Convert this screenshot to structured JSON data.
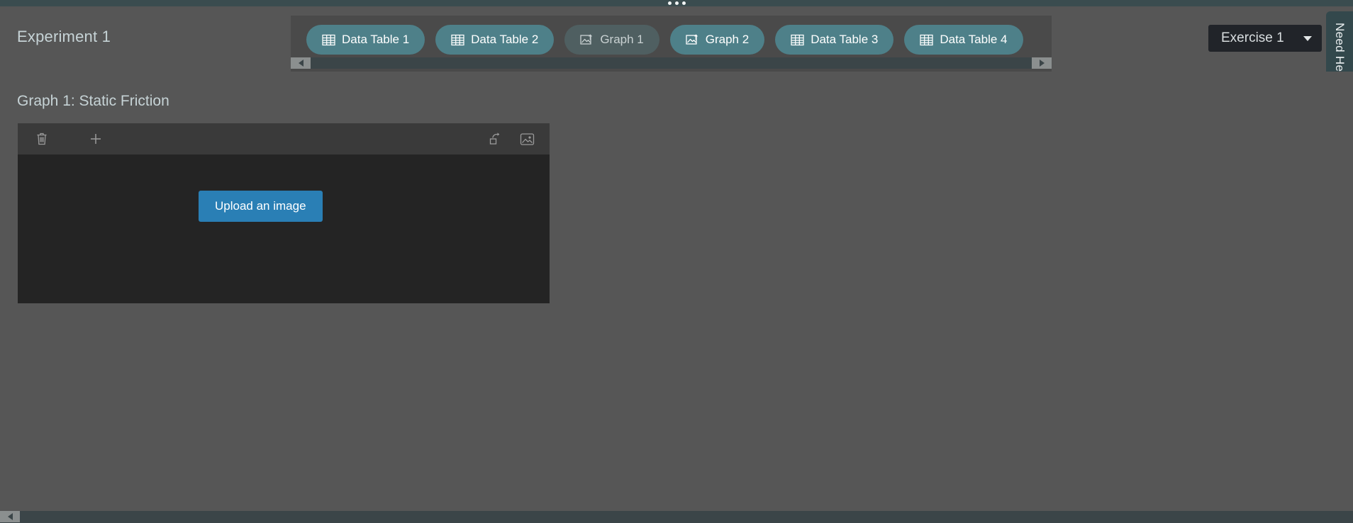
{
  "window": {
    "drag_handle_icon": "drag-dots-icon",
    "background_color": "#565656"
  },
  "header": {
    "experiment_title": "Experiment 1",
    "exercise_selector": {
      "value": "Exercise 1",
      "caret_icon": "chevron-down-icon"
    },
    "need_help_label": "Need Help?"
  },
  "tabstrip": {
    "scroll_left_icon": "arrow-left-icon",
    "scroll_right_icon": "arrow-right-icon",
    "tabs": [
      {
        "label": "Data Table 1",
        "icon": "table-icon",
        "active": false
      },
      {
        "label": "Data Table 2",
        "icon": "table-icon",
        "active": false
      },
      {
        "label": "Graph 1",
        "icon": "image-upload-icon",
        "active": true
      },
      {
        "label": "Graph 2",
        "icon": "image-upload-icon",
        "active": false
      },
      {
        "label": "Data Table 3",
        "icon": "table-icon",
        "active": false
      },
      {
        "label": "Data Table 4",
        "icon": "table-icon",
        "active": false
      }
    ]
  },
  "main": {
    "graph_heading": "Graph 1: Static Friction",
    "toolbar": {
      "delete_icon": "trash-icon",
      "add_icon": "plus-icon",
      "rotate_icon": "rotate-icon",
      "image_icon": "picture-icon"
    },
    "upload_button_label": "Upload an image"
  },
  "colors": {
    "accent_blue": "#2a7fb5",
    "tab_teal": "#4e8089",
    "tab_active": "#4f5f61",
    "need_help_teal": "#33484c",
    "panel_dark": "#242424",
    "toolbar_dark": "#3a3a3a",
    "text_light": "#c6d3d6"
  }
}
